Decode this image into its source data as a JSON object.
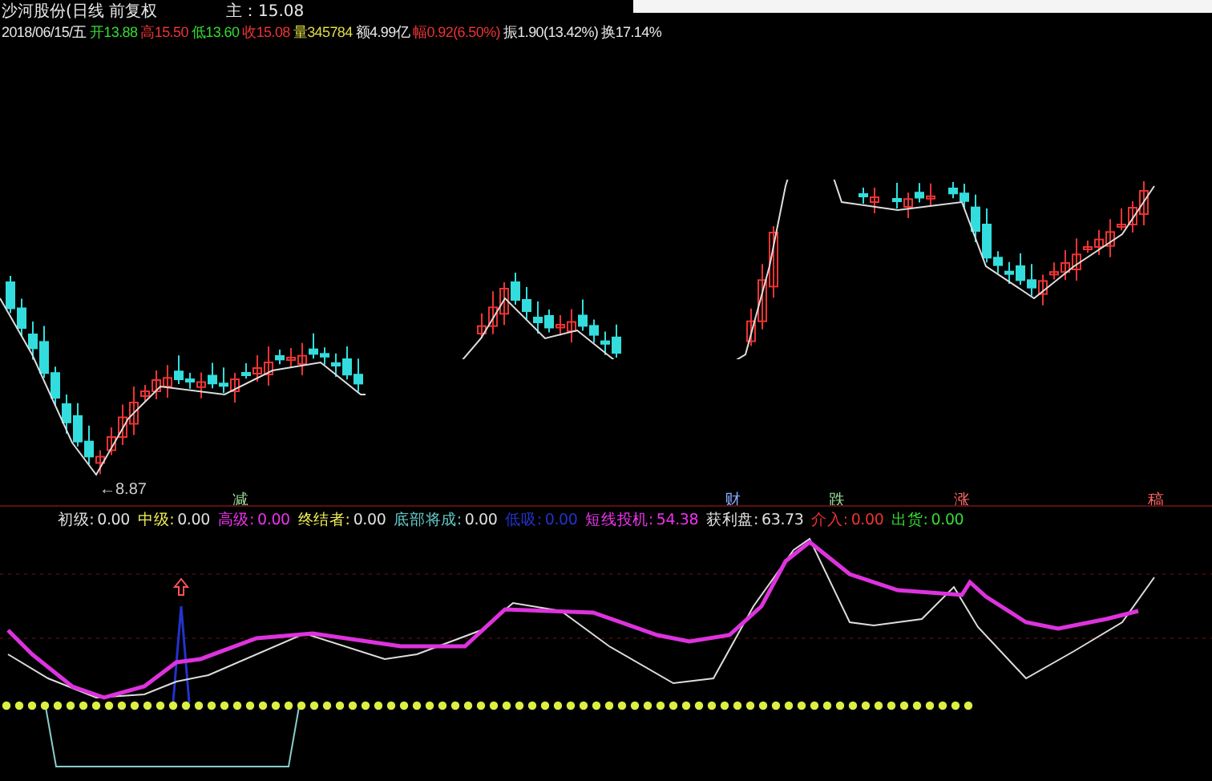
{
  "header": {
    "title": "沙河股份(日线 前复权",
    "main_label": "主：15.08"
  },
  "quote": [
    {
      "text": "2018/06/15/五",
      "color": "#e8e8e8"
    },
    {
      "text": "开13.88",
      "color": "#33dd33"
    },
    {
      "text": "高15.50",
      "color": "#ee3333"
    },
    {
      "text": "低13.60",
      "color": "#33dd33"
    },
    {
      "text": "收15.08",
      "color": "#ee3333"
    },
    {
      "text": "量345784",
      "color": "#dddd44"
    },
    {
      "text": "额4.99亿",
      "color": "#e8e8e8"
    },
    {
      "text": "幅0.92(6.50%)",
      "color": "#ee3333"
    },
    {
      "text": "振1.90(13.42%)",
      "color": "#e8e8e8"
    },
    {
      "text": "换17.14%",
      "color": "#e8e8e8"
    }
  ],
  "candle_panel": {
    "low_label": "←8.87",
    "markers": [
      {
        "text": "减",
        "color": "#99dd99"
      },
      {
        "text": "财",
        "color": "#88aaff"
      },
      {
        "text": "跌",
        "color": "#99dd99"
      },
      {
        "text": "涨",
        "color": "#ff6666"
      },
      {
        "text": "稿",
        "color": "#ff6666"
      }
    ]
  },
  "indicator_legend": [
    {
      "label": {
        "text": "初级:",
        "color": "#e0e0e0"
      },
      "value": {
        "text": "0.00",
        "color": "#e0e0e0"
      }
    },
    {
      "label": {
        "text": "中级:",
        "color": "#eeee55"
      },
      "value": {
        "text": "0.00",
        "color": "#e0e0e0"
      }
    },
    {
      "label": {
        "text": "高级:",
        "color": "#ee33ee"
      },
      "value": {
        "text": "0.00",
        "color": "#ee33ee"
      }
    },
    {
      "label": {
        "text": "终结者:",
        "color": "#eeee55"
      },
      "value": {
        "text": "0.00",
        "color": "#e0e0e0"
      }
    },
    {
      "label": {
        "text": "底部将成:",
        "color": "#66cccc"
      },
      "value": {
        "text": "0.00",
        "color": "#e0e0e0"
      }
    },
    {
      "label": {
        "text": "低吸:",
        "color": "#2233cc"
      },
      "value": {
        "text": "0.00",
        "color": "#2233cc"
      }
    },
    {
      "label": {
        "text": "短线投机:",
        "color": "#ee33ee"
      },
      "value": {
        "text": "54.38",
        "color": "#ee33ee"
      }
    },
    {
      "label": {
        "text": "获利盘:",
        "color": "#e0e0e0"
      },
      "value": {
        "text": "63.73",
        "color": "#e0e0e0"
      }
    },
    {
      "label": {
        "text": "介入:",
        "color": "#ee3333"
      },
      "value": {
        "text": "0.00",
        "color": "#ee3333"
      }
    },
    {
      "label": {
        "text": "出货:",
        "color": "#33dd33"
      },
      "value": {
        "text": "0.00",
        "color": "#33dd33"
      }
    }
  ]
}
